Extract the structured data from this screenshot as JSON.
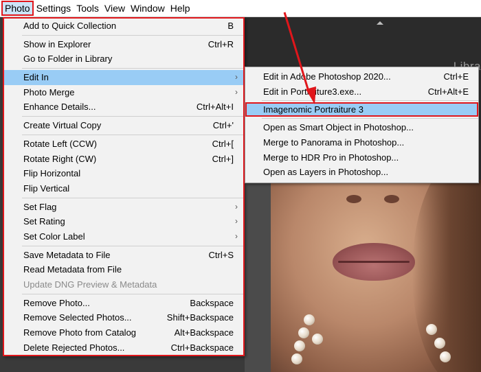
{
  "menubar": {
    "items": [
      "Photo",
      "Settings",
      "Tools",
      "View",
      "Window",
      "Help"
    ]
  },
  "app": {
    "module_label": "Libra"
  },
  "photo_menu": {
    "group1": [
      {
        "label": "Add to Quick Collection",
        "shortcut": "B"
      }
    ],
    "group2": [
      {
        "label": "Show in Explorer",
        "shortcut": "Ctrl+R"
      },
      {
        "label": "Go to Folder in Library",
        "shortcut": ""
      }
    ],
    "group3": [
      {
        "label": "Edit In",
        "shortcut": ""
      },
      {
        "label": "Photo Merge",
        "shortcut": ""
      },
      {
        "label": "Enhance Details...",
        "shortcut": "Ctrl+Alt+I"
      }
    ],
    "group4": [
      {
        "label": "Create Virtual Copy",
        "shortcut": "Ctrl+'"
      }
    ],
    "group5": [
      {
        "label": "Rotate Left (CCW)",
        "shortcut": "Ctrl+["
      },
      {
        "label": "Rotate Right (CW)",
        "shortcut": "Ctrl+]"
      },
      {
        "label": "Flip Horizontal",
        "shortcut": ""
      },
      {
        "label": "Flip Vertical",
        "shortcut": ""
      }
    ],
    "group6": [
      {
        "label": "Set Flag",
        "shortcut": ""
      },
      {
        "label": "Set Rating",
        "shortcut": ""
      },
      {
        "label": "Set Color Label",
        "shortcut": ""
      }
    ],
    "group7": [
      {
        "label": "Save Metadata to File",
        "shortcut": "Ctrl+S"
      },
      {
        "label": "Read Metadata from File",
        "shortcut": ""
      },
      {
        "label": "Update DNG Preview & Metadata",
        "shortcut": ""
      }
    ],
    "group8": [
      {
        "label": "Remove Photo...",
        "shortcut": "Backspace"
      },
      {
        "label": "Remove Selected Photos...",
        "shortcut": "Shift+Backspace"
      },
      {
        "label": "Remove Photo from Catalog",
        "shortcut": "Alt+Backspace"
      },
      {
        "label": "Delete Rejected Photos...",
        "shortcut": "Ctrl+Backspace"
      }
    ]
  },
  "edit_in_submenu": {
    "items": [
      {
        "label": "Edit in Adobe Photoshop 2020...",
        "shortcut": "Ctrl+E"
      },
      {
        "label": "Edit in Portraiture3.exe...",
        "shortcut": "Ctrl+Alt+E"
      },
      {
        "label": "Imagenomic Portraiture 3",
        "shortcut": ""
      },
      {
        "label": "Open as Smart Object in Photoshop...",
        "shortcut": ""
      },
      {
        "label": "Merge to Panorama in Photoshop...",
        "shortcut": ""
      },
      {
        "label": "Merge to HDR Pro in Photoshop...",
        "shortcut": ""
      },
      {
        "label": "Open as Layers in Photoshop...",
        "shortcut": ""
      }
    ]
  },
  "colors": {
    "highlight": "#99ccf5",
    "annotation_red": "#e0161b",
    "menu_bg": "#f2f2f2"
  }
}
